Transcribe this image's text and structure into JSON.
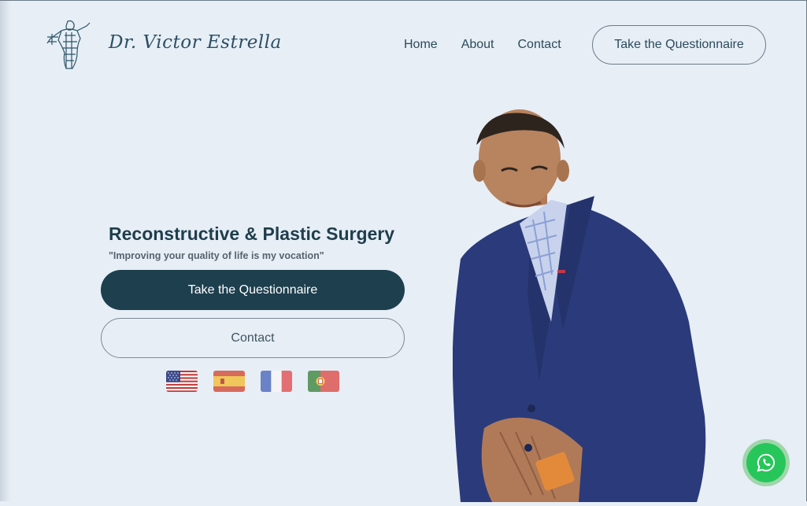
{
  "header": {
    "brand": "Dr. Victor Estrella",
    "logo_icon": "anatomy-figure-icon",
    "nav": [
      {
        "label": "Home"
      },
      {
        "label": "About"
      },
      {
        "label": "Contact"
      }
    ],
    "cta_label": "Take the Questionnaire"
  },
  "hero": {
    "title": "Reconstructive & Plastic Surgery",
    "subtitle": "\"Improving your quality of life is my vocation\"",
    "primary_button": "Take the Questionnaire",
    "secondary_button": "Contact",
    "languages": [
      {
        "icon": "us-flag-icon"
      },
      {
        "icon": "spain-flag-icon"
      },
      {
        "icon": "france-flag-icon"
      },
      {
        "icon": "portugal-flag-icon"
      }
    ],
    "portrait_icon": "doctor-portrait"
  },
  "floating": {
    "whatsapp_icon": "whatsapp-icon"
  },
  "colors": {
    "background": "#e7eef6",
    "primary": "#1e3f4e",
    "text": "#1f3d4c",
    "whatsapp": "#27c65a"
  }
}
